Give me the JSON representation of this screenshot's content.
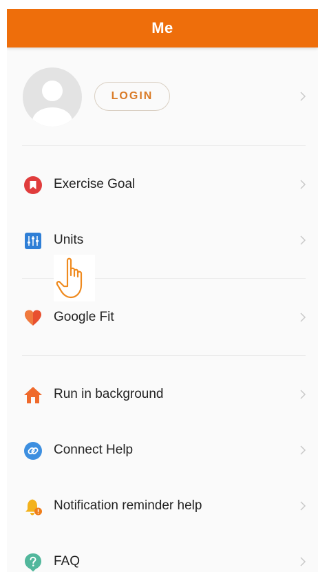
{
  "header": {
    "title": "Me"
  },
  "profile": {
    "login_label": "LOGIN"
  },
  "menu": {
    "items": [
      {
        "label": "Exercise Goal",
        "icon": "goal-badge-icon"
      },
      {
        "label": "Units",
        "icon": "units-equalizer-icon"
      },
      {
        "label": "Google Fit",
        "icon": "google-fit-heart-icon"
      },
      {
        "label": "Run in background",
        "icon": "home-icon"
      },
      {
        "label": "Connect Help",
        "icon": "link-icon"
      },
      {
        "label": "Notification reminder help",
        "icon": "bell-alert-icon"
      },
      {
        "label": "FAQ",
        "icon": "question-icon"
      }
    ]
  },
  "colors": {
    "header": "#ee6e0b",
    "accent": "#d97a26",
    "background": "#fafafa"
  }
}
